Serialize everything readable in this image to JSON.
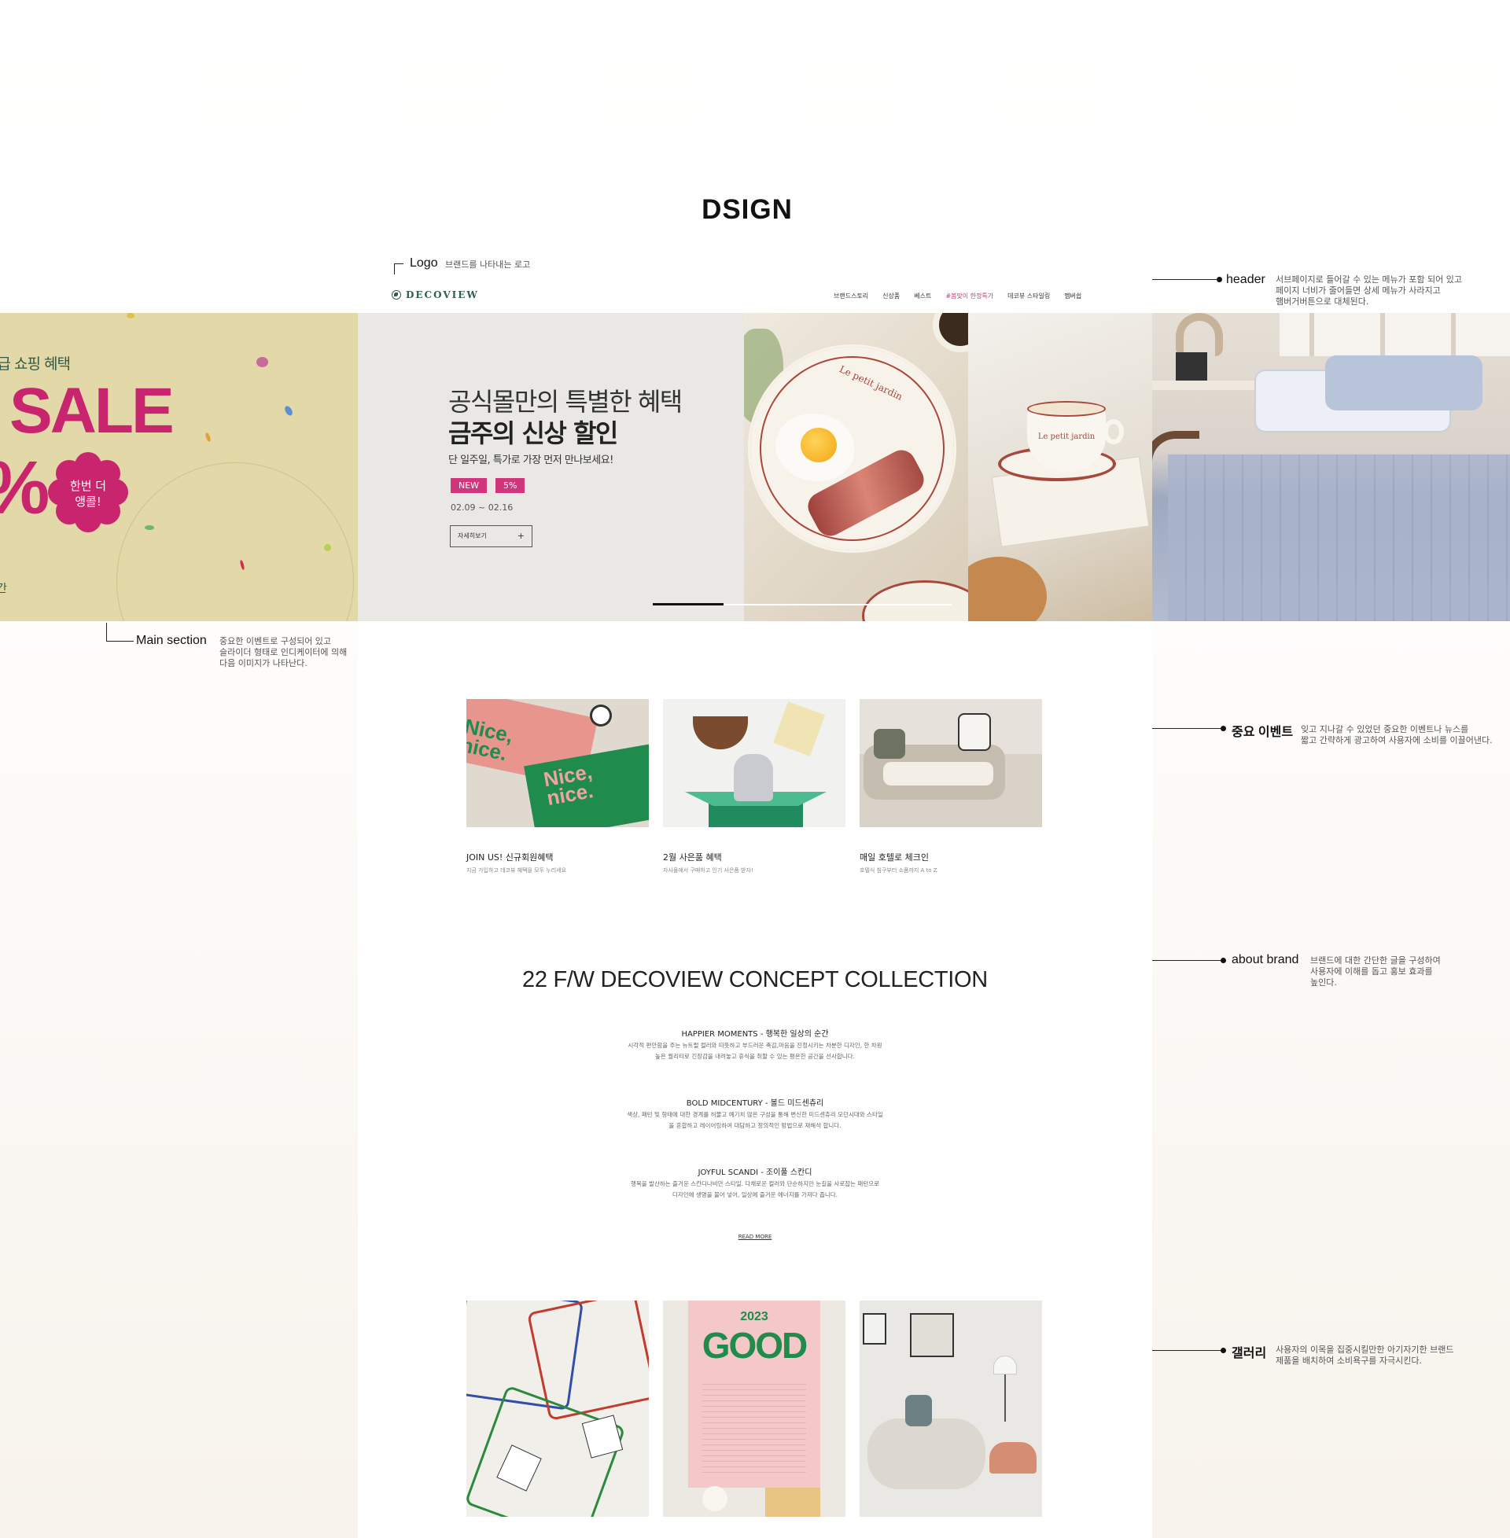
{
  "page_title": "DSIGN",
  "annotations": {
    "logo": {
      "title": "Logo",
      "desc": [
        "브랜드를 나타내는 로고"
      ]
    },
    "header": {
      "title": "header",
      "desc": [
        "서브페이지로 들어갈 수 있는 메뉴가 포함 되어 있고",
        "페이지 너비가 줄어들면 상세 메뉴가 사라지고",
        "햄버거버튼으로 대체된다."
      ]
    },
    "main_section": {
      "title": "Main section",
      "desc": [
        "중요한 이벤트로 구성되어 있고",
        "슬라이더 형태로 인디케이터에 의해",
        "다음 이미지가 나타난다."
      ]
    },
    "event": {
      "title": "중요 이벤트",
      "desc": [
        "잊고 지나갈 수 있었던 중요한 이벤트나 뉴스를",
        "짧고 간략하게 광고하여 사용자에 소비를 이끌어낸다."
      ]
    },
    "about": {
      "title": "about brand",
      "desc": [
        "브랜드에 대한 간단한 글을 구성하여",
        "사용자에 이해를 돕고 홍보 효과를",
        "높인다."
      ]
    },
    "gallery": {
      "title": "갤러리",
      "desc": [
        "사용자의 이목을 집중시킬만한 아기자기한 브랜드",
        "제품을 배치하여 소비욕구를 자극시킨다."
      ]
    }
  },
  "site": {
    "logo": "DECOVIEW",
    "nav": [
      "브랜드스토리",
      "신상품",
      "베스트",
      "#봄맞이 한정특가",
      "데코뷰 스타일링",
      "멤버쉽"
    ],
    "hero": {
      "line1": "공식몰만의 특별한 혜택",
      "line2": "금주의 신상 할인",
      "line3": "단 일주일, 특가로 가장 먼저 만나보세요!",
      "badges": [
        "NEW",
        "5%"
      ],
      "date": "02.09 ~ 02.16",
      "button": "자세히보기",
      "button_icon": "+",
      "plate_text": "Le petit jardin",
      "cup_text": "Le petit jardin"
    },
    "left_banner": {
      "line1": "특급 쇼핑 혜택",
      "sale": "SALE",
      "percent": "%",
      "flower": [
        "한번 더",
        "앵콜!"
      ],
      "bottom": "간"
    },
    "events": [
      {
        "title": "JOIN US! 신규회원혜택",
        "desc": "지금 가입하고 데코뷰 혜택을 모두 누리세요",
        "img_text": [
          "Nice,",
          "nice.",
          "Nice,",
          "nice."
        ]
      },
      {
        "title": "2월 사은품 혜택",
        "desc": "자사몰에서 구매하고 인기 사은품 받자!"
      },
      {
        "title": "매일 호텔로 체크인",
        "desc": "호텔식 침구부터 소품까지 A to Z"
      }
    ],
    "concept": {
      "title": "22 F/W DECOVIEW CONCEPT COLLECTION",
      "items": [
        {
          "heading": "HAPPIER MOMENTS - 행복한 일상의 순간",
          "lines": [
            "시각적 편안함을 주는 뉴트럴 컬러와 따뜻하고 부드러운 촉감,마음을 진정시키는 차분한 디자인, 한 차원",
            "높은 퀄리티로 긴장감을 내려놓고 휴식을 취할 수 있는 평온한 공간을 선사합니다."
          ]
        },
        {
          "heading": "BOLD MIDCENTURY - 볼드 미드센츄리",
          "lines": [
            "색상, 패턴 및 형태에 대한 경계를 허물고 예기치 않은 구성을 통해 변신한 미드센츄리 모던시대와 스타일",
            "을 혼합하고 레이어링하여 대담하고 창의적인 방법으로 재해석 합니다."
          ]
        },
        {
          "heading": "JOYFUL SCANDI - 조이풀 스칸디",
          "lines": [
            "행복을 발산하는 즐거운 스칸디나비안 스타일. 다채로운 컬러와 단순하지만 눈길을 사로잡는 패턴으로",
            "디자인에 생명을 불어 넣어, 일상에 즐거운 에너지를 가져다 줍니다."
          ]
        }
      ],
      "read_more": "READ MORE"
    },
    "gallery": {
      "calendar_year": "2023",
      "calendar_word": "GOOD"
    }
  },
  "colors": {
    "accent_pink": "#d1357b",
    "brand_green": "#2f5d4e",
    "hero_bg": "#eae8e4",
    "banner_yellow": "#e2d8a8"
  }
}
